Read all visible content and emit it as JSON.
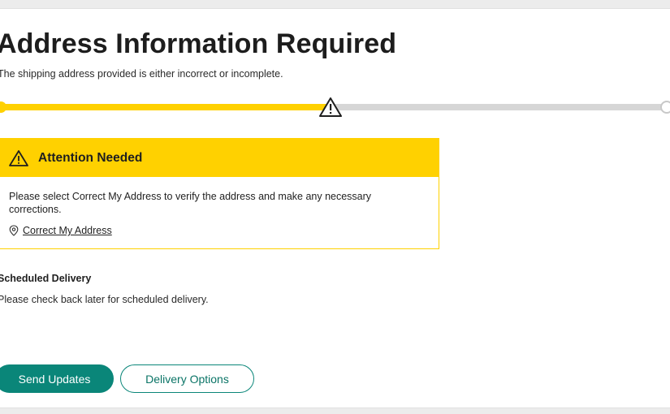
{
  "header": {
    "title": "Address Information Required",
    "subtitle": "The shipping address provided is either incorrect or incomplete."
  },
  "progress": {
    "fraction_complete": 0.49,
    "marker_icon": "warning-triangle-icon",
    "fill_color": "#ffd100",
    "track_color": "#d6d6d6"
  },
  "alert": {
    "icon": "warning-triangle-icon",
    "title": "Attention Needed",
    "message": "Please select Correct My Address to verify the address and make any necessary corrections.",
    "link_icon": "location-pin-icon",
    "link_label": "Correct My Address",
    "accent_color": "#ffd100"
  },
  "scheduled": {
    "title": "Scheduled Delivery",
    "text": "Please check back later for scheduled delivery."
  },
  "actions": {
    "send_updates_label": "Send Updates",
    "delivery_options_label": "Delivery Options",
    "primary_color": "#0a8679"
  }
}
